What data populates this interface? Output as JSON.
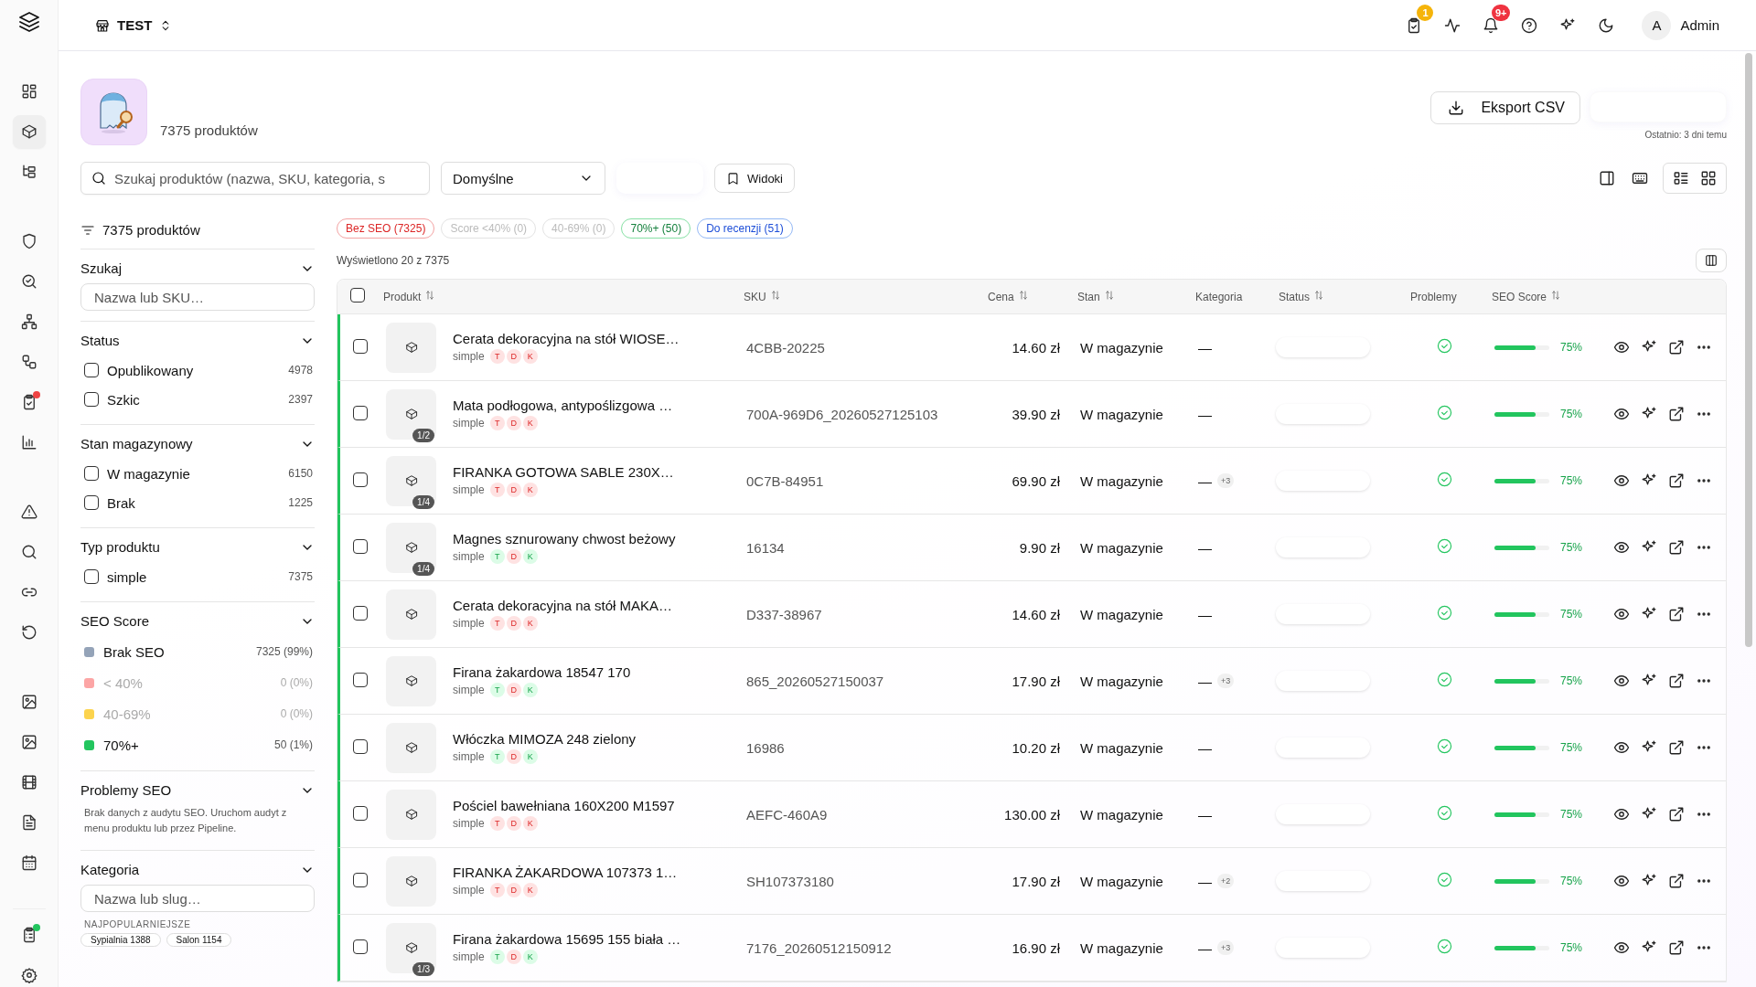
{
  "rail": {
    "groups": [
      [
        {
          "selected": false
        },
        {
          "selected": true
        },
        {
          "selected": false
        }
      ],
      [
        {
          "selected": false
        },
        {
          "selected": false
        },
        {
          "selected": false
        },
        {
          "selected": false
        },
        {
          "selected": false,
          "color": "#ef4444"
        },
        {
          "selected": false
        }
      ],
      [
        {
          "selected": false
        },
        {
          "selected": false
        },
        {
          "selected": false
        },
        {
          "selected": false
        }
      ],
      [
        {
          "selected": false
        },
        {
          "selected": false
        },
        {
          "selected": false
        },
        {
          "selected": false
        },
        {
          "selected": false
        }
      ],
      [
        {
          "selected": false,
          "color": "#22c55e"
        },
        {
          "selected": false
        }
      ]
    ]
  },
  "header": {
    "store": "TEST",
    "tasks_badge": "1",
    "alerts_badge": "9+",
    "avatar_letter": "A",
    "user": "Admin"
  },
  "page": {
    "product_count": "7375 produktów",
    "export_button": "Eksport CSV",
    "last_export": "Ostatnio: 3 dni temu"
  },
  "toolbar": {
    "search_placeholder": "Szukaj produktów (nazwa, SKU, kategoria, s",
    "sort_value": "Domyślne",
    "views_button": "Widoki",
    "view_modes": [
      {
        "selected": false
      },
      {
        "selected": false
      }
    ]
  },
  "filters": {
    "summary": "7375 produktów",
    "sections": [
      {
        "kind": "search",
        "title": "Szukaj",
        "placeholder": "Nazwa lub SKU…"
      },
      {
        "kind": "checks",
        "title": "Status",
        "items": [
          {
            "label": "Opublikowany",
            "count": "4978",
            "checked": false
          },
          {
            "label": "Szkic",
            "count": "2397",
            "checked": false
          }
        ]
      },
      {
        "kind": "checks",
        "title": "Stan magazynowy",
        "items": [
          {
            "label": "W magazynie",
            "count": "6150",
            "checked": false
          },
          {
            "label": "Brak",
            "count": "1225",
            "checked": false
          }
        ]
      },
      {
        "kind": "checks",
        "title": "Typ produktu",
        "items": [
          {
            "label": "simple",
            "count": "7375",
            "checked": false
          }
        ]
      },
      {
        "kind": "legend",
        "title": "SEO Score",
        "items": [
          {
            "label": "Brak SEO",
            "count": "7325 (99%)",
            "color": "#94a3b8",
            "disabled": false
          },
          {
            "label": "< 40%",
            "count": "0 (0%)",
            "color": "#fca5a5",
            "disabled": true
          },
          {
            "label": "40-69%",
            "count": "0 (0%)",
            "color": "#fcd34d",
            "disabled": true
          },
          {
            "label": "70%+",
            "count": "50 (1%)",
            "color": "#22c55e",
            "disabled": false
          }
        ]
      },
      {
        "kind": "note",
        "title": "Problemy SEO",
        "text": "Brak danych z audytu SEO. Uruchom audyt z menu produktu lub przez Pipeline."
      },
      {
        "kind": "category",
        "title": "Kategoria",
        "placeholder": "Nazwa lub slug…",
        "popular_label": "NAJPOPULARNIEJSZE",
        "chips": [
          {
            "label": "Sypialnia",
            "count": "1388"
          },
          {
            "label": "Salon",
            "count": "1154"
          }
        ]
      }
    ]
  },
  "quick_filters": [
    {
      "label": "Bez SEO (7325)",
      "kind": "danger"
    },
    {
      "label": "Score <40% (0)",
      "kind": "muted"
    },
    {
      "label": "40-69% (0)",
      "kind": "muted"
    },
    {
      "label": "70%+ (50)",
      "kind": "success"
    },
    {
      "label": "Do recenzji (51)",
      "kind": "info"
    }
  ],
  "shown": "Wyświetlono 20 z 7375",
  "table": {
    "select_all_checked": false,
    "columns": [
      {
        "label": "Produkt",
        "sortable": true
      },
      {
        "label": "SKU",
        "sortable": true
      },
      {
        "label": "Cena",
        "sortable": true
      },
      {
        "label": "Stan",
        "sortable": true
      },
      {
        "label": "Kategoria",
        "sortable": false
      },
      {
        "label": "Status",
        "sortable": true
      },
      {
        "label": "Problemy",
        "sortable": false
      },
      {
        "label": "SEO Score",
        "sortable": true
      }
    ],
    "rows": [
      {
        "checked": false,
        "name": "Cerata dekoracyjna na stół WIOSE…",
        "type": "simple",
        "tags": [
          {
            "label": "T",
            "ok": false
          },
          {
            "label": "D",
            "ok": false
          },
          {
            "label": "K",
            "ok": false
          }
        ],
        "sku": "4CBB-20225",
        "price": "14.60 zł",
        "stock": "W magazynie",
        "category": "—",
        "level": 0.75,
        "score": "75%"
      },
      {
        "checked": false,
        "name": "Mata podłogowa, antypoślizgowa …",
        "type": "simple",
        "image_count": "1/2",
        "tags": [
          {
            "label": "T",
            "ok": false
          },
          {
            "label": "D",
            "ok": false
          },
          {
            "label": "K",
            "ok": false
          }
        ],
        "sku": "700A-969D6_20260527125103",
        "price": "39.90 zł",
        "stock": "W magazynie",
        "category": "—",
        "level": 0.75,
        "score": "75%"
      },
      {
        "checked": false,
        "name": "FIRANKA GOTOWA SABLE 230X…",
        "type": "simple",
        "image_count": "1/4",
        "tags": [
          {
            "label": "T",
            "ok": false
          },
          {
            "label": "D",
            "ok": false
          },
          {
            "label": "K",
            "ok": false
          }
        ],
        "sku": "0C7B-84951",
        "price": "69.90 zł",
        "stock": "W magazynie",
        "category": "—",
        "category_more": "+3",
        "level": 0.75,
        "score": "75%"
      },
      {
        "checked": false,
        "name": "Magnes sznurowany chwost beżowy",
        "type": "simple",
        "image_count": "1/4",
        "tags": [
          {
            "label": "T",
            "ok": true
          },
          {
            "label": "D",
            "ok": false
          },
          {
            "label": "K",
            "ok": true
          }
        ],
        "sku": "16134",
        "price": "9.90 zł",
        "stock": "W magazynie",
        "category": "—",
        "level": 0.75,
        "score": "75%"
      },
      {
        "checked": false,
        "name": "Cerata dekoracyjna na stół MAKA…",
        "type": "simple",
        "tags": [
          {
            "label": "T",
            "ok": false
          },
          {
            "label": "D",
            "ok": false
          },
          {
            "label": "K",
            "ok": false
          }
        ],
        "sku": "D337-38967",
        "price": "14.60 zł",
        "stock": "W magazynie",
        "category": "—",
        "level": 0.75,
        "score": "75%"
      },
      {
        "checked": false,
        "name": "Firana żakardowa 18547 170",
        "type": "simple",
        "tags": [
          {
            "label": "T",
            "ok": true
          },
          {
            "label": "D",
            "ok": false
          },
          {
            "label": "K",
            "ok": true
          }
        ],
        "sku": "865_20260527150037",
        "price": "17.90 zł",
        "stock": "W magazynie",
        "category": "—",
        "category_more": "+3",
        "level": 0.75,
        "score": "75%"
      },
      {
        "checked": false,
        "name": "Włóczka MIMOZA 248 zielony",
        "type": "simple",
        "tags": [
          {
            "label": "T",
            "ok": true
          },
          {
            "label": "D",
            "ok": false
          },
          {
            "label": "K",
            "ok": true
          }
        ],
        "sku": "16986",
        "price": "10.20 zł",
        "stock": "W magazynie",
        "category": "—",
        "level": 0.75,
        "score": "75%"
      },
      {
        "checked": false,
        "name": "Pościel bawełniana 160X200 M1597",
        "type": "simple",
        "tags": [
          {
            "label": "T",
            "ok": false
          },
          {
            "label": "D",
            "ok": false
          },
          {
            "label": "K",
            "ok": false
          }
        ],
        "sku": "AEFC-460A9",
        "price": "130.00 zł",
        "stock": "W magazynie",
        "category": "—",
        "level": 0.75,
        "score": "75%"
      },
      {
        "checked": false,
        "name": "FIRANKA ŻAKARDOWA 107373 1…",
        "type": "simple",
        "tags": [
          {
            "label": "T",
            "ok": false
          },
          {
            "label": "D",
            "ok": false
          },
          {
            "label": "K",
            "ok": false
          }
        ],
        "sku": "SH107373180",
        "price": "17.90 zł",
        "stock": "W magazynie",
        "category": "—",
        "category_more": "+2",
        "level": 0.75,
        "score": "75%"
      },
      {
        "checked": false,
        "name": "Firana żakardowa 15695 155 biała …",
        "type": "simple",
        "image_count": "1/3",
        "tags": [
          {
            "label": "T",
            "ok": true
          },
          {
            "label": "D",
            "ok": false
          },
          {
            "label": "K",
            "ok": true
          }
        ],
        "sku": "7176_20260512150912",
        "price": "16.90 zł",
        "stock": "W magazynie",
        "category": "—",
        "category_more": "+3",
        "level": 0.75,
        "score": "75%"
      }
    ]
  }
}
